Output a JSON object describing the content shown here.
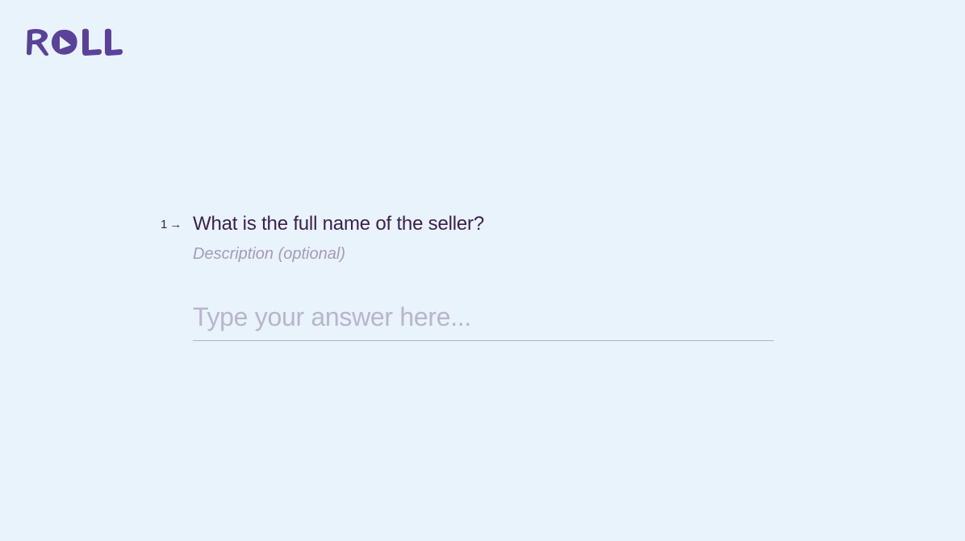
{
  "brand": {
    "name": "ROLL",
    "color": "#5a4199"
  },
  "question": {
    "number": "1",
    "arrow_icon": "arrow-right-icon",
    "title": "What is the full name of the seller?",
    "description": "Description (optional)"
  },
  "answer": {
    "placeholder": "Type your answer here...",
    "value": ""
  },
  "colors": {
    "background": "#e8f3fc",
    "text": "#3b1f4f",
    "muted": "#a49bb8",
    "underline": "#b4b1c6"
  }
}
